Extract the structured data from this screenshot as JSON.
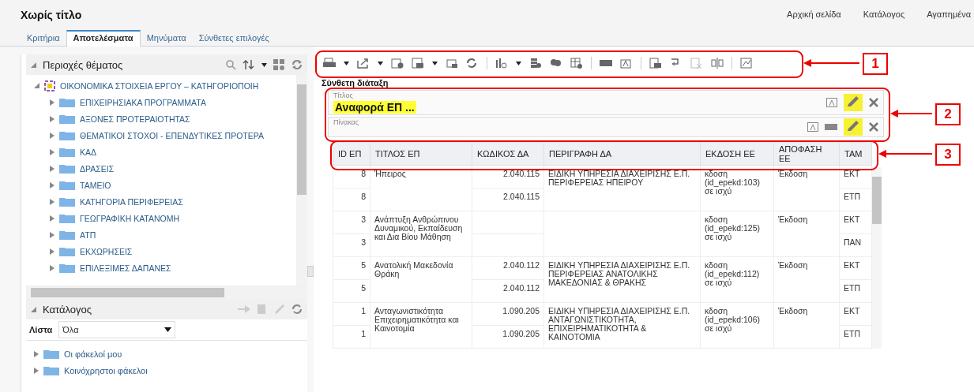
{
  "window": {
    "title": "Χωρίς τίτλο"
  },
  "top_links": [
    {
      "label": "Αρχική σελίδα"
    },
    {
      "label": "Κατάλογος"
    },
    {
      "label": "Αγαπημένα"
    }
  ],
  "tabs": [
    {
      "label": "Κριτήρια",
      "selected": false
    },
    {
      "label": "Αποτελέσματα",
      "selected": true
    },
    {
      "label": "Μηνύματα",
      "selected": false
    },
    {
      "label": "Σύνθετες επιλογές",
      "selected": false
    }
  ],
  "subject_areas": {
    "title": "Περιοχές θέματος",
    "tree": [
      {
        "label": "ΟΙΚΟΝΟΜΙΚΑ ΣΤΟΙΧΕΙΑ ΕΡΓΟΥ – ΚΑΤΗΓΟΡΙΟΠΟΙΗ",
        "expanded": true,
        "children": [
          {
            "label": "ΕΠΙΧΕΙΡΗΣΙΑΚΑ ΠΡΟΓΡΑΜΜΑΤΑ",
            "expanded": false
          },
          {
            "label": "ΑΞΟΝΕΣ ΠΡΟΤΕΡΑΙΟΤΗΤΑΣ",
            "expanded": false
          },
          {
            "label": "ΘΕΜΑΤΙΚΟΙ ΣΤΟΧΟΙ - ΕΠΕΝΔΥΤΙΚΕΣ ΠΡΟΤΕΡΑ",
            "expanded": false
          },
          {
            "label": "ΚΑΔ",
            "expanded": false
          },
          {
            "label": "ΔΡΑΣΕΙΣ",
            "expanded": false
          },
          {
            "label": "ΤΑΜΕΙΟ",
            "expanded": false
          },
          {
            "label": "ΚΑΤΗΓΟΡΙΑ ΠΕΡΙΦΕΡΕΙΑΣ",
            "expanded": false
          },
          {
            "label": "ΓΕΩΓΡΑΦΙΚΗ ΚΑΤΑΝΟΜΗ",
            "expanded": false
          },
          {
            "label": "ΑΤΠ",
            "expanded": false
          },
          {
            "label": "ΕΚΧΩΡΗΣΕΙΣ",
            "expanded": false
          },
          {
            "label": "ΕΠΙΛΕΞΙΜΕΣ ΔΑΠΑΝΕΣ",
            "expanded": false
          }
        ]
      }
    ]
  },
  "catalog": {
    "title": "Κατάλογος",
    "list_label": "Λίστα",
    "list_value": "Όλα",
    "folders": [
      {
        "label": "Οι φάκελοί μου",
        "expanded": false
      },
      {
        "label": "Κοινόχρηστοι φάκελοι",
        "expanded": false
      }
    ]
  },
  "compound_layout": {
    "title": "Σύνθετη διάταξη",
    "views": [
      {
        "kind": "title",
        "label": "Τίτλος",
        "value": "Αναφορά ΕΠ ..."
      },
      {
        "kind": "table",
        "label": "Πίνακας"
      }
    ]
  },
  "table": {
    "columns": [
      "ID ΕΠ",
      "ΤΙΤΛΟΣ ΕΠ",
      "ΚΩΔΙΚΟΣ ΔΑ",
      "ΠΕΡΙΓΡΑΦΗ ΔΑ",
      "ΕΚΔΟΣΗ ΕΕ",
      "ΑΠΟΦΑΣΗ ΕΕ",
      "ΤΑΜ"
    ],
    "groups": [
      {
        "title": "Ήπειρος",
        "description": "ΕΙΔΙΚΗ ΥΠΗΡΕΣΙΑ ΔΙΑΧΕΙΡΙΣΗΣ Ε.Π. ΠΕΡΙΦΕΡΕΙΑΣ ΗΠΕΙΡΟΥ",
        "edition": "κδοση (id_epekd:103) σε ισχύ",
        "decision": "Έκδοση",
        "rows": [
          {
            "id": "8",
            "code": "2.040.115",
            "fund": "ΕΚΤ"
          },
          {
            "id": "8",
            "code": "2.040.115",
            "fund": "ΕΤΠ"
          }
        ]
      },
      {
        "title": "Ανάπτυξη Ανθρώπινου Δυναμικού, Εκπαίδευση και Δια Βίου Μάθηση",
        "edition": "κδοση (id_epekd:125) σε ισχύ",
        "decision": "Έκδοση",
        "rows": [
          {
            "id": "3",
            "code": "",
            "fund": "ΕΚΤ"
          },
          {
            "id": "3",
            "code": "",
            "fund": "ΠΑΝ"
          }
        ]
      },
      {
        "title": "Ανατολική Μακεδονία Θράκη",
        "description": "ΕΙΔΙΚΗ ΥΠΗΡΕΣΙΑ ΔΙΑΧΕΙΡΙΣΗΣ Ε.Π. ΠΕΡΙΦΕΡΕΙΑΣ ΑΝΑΤΟΛΙΚΗΣ ΜΑΚΕΔΟΝΙΑΣ & ΘΡΑΚΗΣ",
        "edition": "κδοση (id_epekd:112) σε ισχύ",
        "decision": "Έκδοση",
        "rows": [
          {
            "id": "5",
            "code": "2.040.112",
            "fund": "ΕΚΤ"
          },
          {
            "id": "5",
            "code": "2.040.112",
            "fund": "ΕΤΠ"
          }
        ]
      },
      {
        "title": "Ανταγωνιστικότητα Επιχειρηματικότητα και Καινοτομία",
        "description": "ΕΙΔΙΚΗ ΥΠΗΡΕΣΙΑ ΔΙΑΧΕΙΡΙΣΗΣ Ε.Π. ΑΝΤΑΓΩΝΙΣΤΙΚΟΤΗΤΑ, ΕΠΙΧΕΙΡΗΜΑΤΙΚΟΤΗΤΑ & ΚΑΙΝΟΤΟΜΙΑ",
        "edition": "κδοση (id_epekd:106) σε ισχύ",
        "decision": "Έκδοση",
        "rows": [
          {
            "id": "1",
            "code": "1.090.205",
            "fund": "ΕΚΤ"
          },
          {
            "id": "1",
            "code": "1.090.205",
            "fund": "ΕΤΠ"
          }
        ]
      }
    ]
  },
  "callouts": [
    {
      "number": "1"
    },
    {
      "number": "2"
    },
    {
      "number": "3"
    }
  ]
}
